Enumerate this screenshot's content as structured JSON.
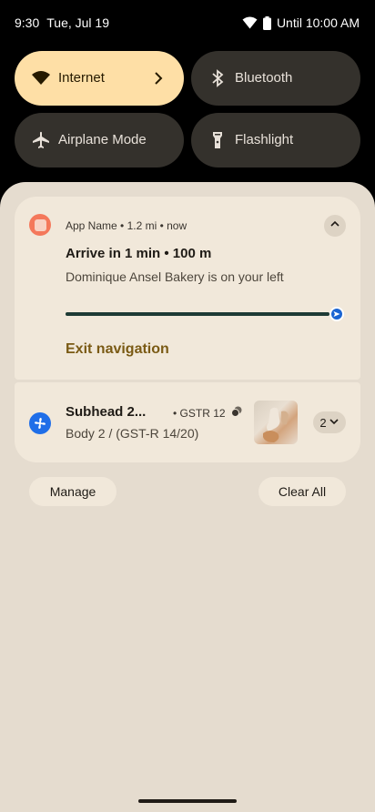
{
  "status_bar": {
    "time": "9:30",
    "date": "Tue, Jul 19",
    "alarm_text": "Until 10:00 AM"
  },
  "quick_settings": [
    {
      "label": "Internet",
      "icon": "wifi-icon",
      "state": "on",
      "has_chevron": true
    },
    {
      "label": "Bluetooth",
      "icon": "bluetooth-icon",
      "state": "off"
    },
    {
      "label": "Airplane Mode",
      "icon": "airplane-icon",
      "state": "off"
    },
    {
      "label": "Flashlight",
      "icon": "flashlight-icon",
      "state": "off"
    }
  ],
  "notifications": {
    "navigation": {
      "app_name": "App Name",
      "meta": "• 1.2 mi • now",
      "title": "Arrive in 1 min • 100 m",
      "body": "Dominique Ansel Bakery is on your left",
      "progress": 1.0,
      "action_label": "Exit navigation"
    },
    "second": {
      "subhead": "Subhead 2...",
      "meta": "• GSTR 12",
      "body": "Body 2 / (GST-R 14/20)",
      "count": "2"
    }
  },
  "buttons": {
    "manage": "Manage",
    "clear_all": "Clear All"
  },
  "colors": {
    "tile_on": "#fedfa6",
    "tile_off": "#34312c",
    "shade": "#e5dccf",
    "card": "#f1e8da",
    "action": "#7a5a14",
    "progress": "#1e3b35",
    "marker": "#1a64d2"
  }
}
